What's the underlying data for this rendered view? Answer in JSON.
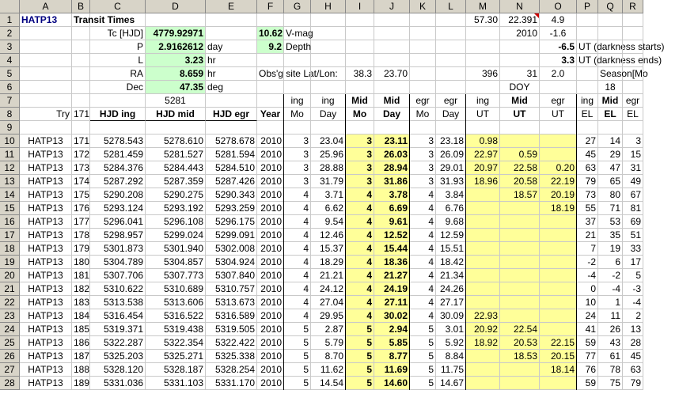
{
  "columns": [
    "A",
    "B",
    "C",
    "D",
    "E",
    "F",
    "G",
    "H",
    "I",
    "J",
    "K",
    "L",
    "M",
    "N",
    "O",
    "P",
    "Q",
    "R"
  ],
  "row_numbers": [
    "1",
    "2",
    "3",
    "4",
    "5",
    "6",
    "7",
    "8",
    "9",
    "10",
    "11",
    "12",
    "13",
    "14",
    "15",
    "16",
    "17",
    "18",
    "19",
    "20",
    "21",
    "22",
    "23",
    "24",
    "25",
    "26",
    "27",
    "28"
  ],
  "top": {
    "a1": "HATP13",
    "b1": "Transit Times",
    "m1": "57.30",
    "n1": "22.391",
    "o1": "4.9",
    "c2": "Tc [HJD]",
    "d2": "4779.92971",
    "f2": "10.62",
    "g2": "V-mag",
    "n2": "2010",
    "o2": "-1.6",
    "c3": "P",
    "d3": "2.9162612",
    "e3": "day",
    "f3": "9.2",
    "g3": "Depth",
    "o3": "-6.5",
    "p3": "UT (darkness starts)",
    "c4": "L",
    "d4": "3.23",
    "e4": "hr",
    "o4": "3.3",
    "p4": "UT (darkness ends)",
    "c5": "RA",
    "d5": "8.659",
    "e5": "hr",
    "f5": "Obs'g site Lat/Lon:",
    "i5": "38.3",
    "j5": "23.70",
    "m5": "396",
    "n5": "31",
    "o5": "2.0",
    "q5": "Season[Mo",
    "c6": "Dec",
    "d6": "47.35",
    "e6": "deg",
    "n6": "DOY",
    "q6": "18",
    "d7": "5281",
    "g7": "ing",
    "h7": "ing",
    "i7": "Mid",
    "j7": "Mid",
    "k7": "egr",
    "l7": "egr",
    "m7": "ing",
    "n7": "Mid",
    "o7": "egr",
    "p7": "ing",
    "q7": "Mid",
    "r7": "egr",
    "a8": "Try",
    "b8": "171",
    "c8": "HJD ing",
    "d8": "HJD mid",
    "e8": "HJD egr",
    "f8": "Year",
    "g8": "Mo",
    "h8": "Day",
    "i8": "Mo",
    "j8": "Day",
    "k8": "Mo",
    "l8": "Day",
    "m8": "UT",
    "n8": "UT",
    "o8": "UT",
    "p8": "EL",
    "q8": "EL",
    "r8": "EL"
  },
  "rows": [
    {
      "a": "HATP13",
      "b": "171",
      "c": "5278.543",
      "d": "5278.610",
      "e": "5278.678",
      "f": "2010",
      "g": "3",
      "h": "23.04",
      "i": "3",
      "j": "23.11",
      "k": "3",
      "l": "23.18",
      "m": "0.98",
      "n": "",
      "o": "",
      "p": "27",
      "q": "14",
      "r": "3"
    },
    {
      "a": "HATP13",
      "b": "172",
      "c": "5281.459",
      "d": "5281.527",
      "e": "5281.594",
      "f": "2010",
      "g": "3",
      "h": "25.96",
      "i": "3",
      "j": "26.03",
      "k": "3",
      "l": "26.09",
      "m": "22.97",
      "n": "0.59",
      "o": "",
      "p": "45",
      "q": "29",
      "r": "15"
    },
    {
      "a": "HATP13",
      "b": "173",
      "c": "5284.376",
      "d": "5284.443",
      "e": "5284.510",
      "f": "2010",
      "g": "3",
      "h": "28.88",
      "i": "3",
      "j": "28.94",
      "k": "3",
      "l": "29.01",
      "m": "20.97",
      "n": "22.58",
      "o": "0.20",
      "p": "63",
      "q": "47",
      "r": "31"
    },
    {
      "a": "HATP13",
      "b": "174",
      "c": "5287.292",
      "d": "5287.359",
      "e": "5287.426",
      "f": "2010",
      "g": "3",
      "h": "31.79",
      "i": "3",
      "j": "31.86",
      "k": "3",
      "l": "31.93",
      "m": "18.96",
      "n": "20.58",
      "o": "22.19",
      "p": "79",
      "q": "65",
      "r": "49"
    },
    {
      "a": "HATP13",
      "b": "175",
      "c": "5290.208",
      "d": "5290.275",
      "e": "5290.343",
      "f": "2010",
      "g": "4",
      "h": "3.71",
      "i": "4",
      "j": "3.78",
      "k": "4",
      "l": "3.84",
      "m": "",
      "n": "18.57",
      "o": "20.19",
      "p": "73",
      "q": "80",
      "r": "67"
    },
    {
      "a": "HATP13",
      "b": "176",
      "c": "5293.124",
      "d": "5293.192",
      "e": "5293.259",
      "f": "2010",
      "g": "4",
      "h": "6.62",
      "i": "4",
      "j": "6.69",
      "k": "4",
      "l": "6.76",
      "m": "",
      "n": "",
      "o": "18.19",
      "p": "55",
      "q": "71",
      "r": "81"
    },
    {
      "a": "HATP13",
      "b": "177",
      "c": "5296.041",
      "d": "5296.108",
      "e": "5296.175",
      "f": "2010",
      "g": "4",
      "h": "9.54",
      "i": "4",
      "j": "9.61",
      "k": "4",
      "l": "9.68",
      "m": "",
      "n": "",
      "o": "",
      "p": "37",
      "q": "53",
      "r": "69"
    },
    {
      "a": "HATP13",
      "b": "178",
      "c": "5298.957",
      "d": "5299.024",
      "e": "5299.091",
      "f": "2010",
      "g": "4",
      "h": "12.46",
      "i": "4",
      "j": "12.52",
      "k": "4",
      "l": "12.59",
      "m": "",
      "n": "",
      "o": "",
      "p": "21",
      "q": "35",
      "r": "51"
    },
    {
      "a": "HATP13",
      "b": "179",
      "c": "5301.873",
      "d": "5301.940",
      "e": "5302.008",
      "f": "2010",
      "g": "4",
      "h": "15.37",
      "i": "4",
      "j": "15.44",
      "k": "4",
      "l": "15.51",
      "m": "",
      "n": "",
      "o": "",
      "p": "7",
      "q": "19",
      "r": "33"
    },
    {
      "a": "HATP13",
      "b": "180",
      "c": "5304.789",
      "d": "5304.857",
      "e": "5304.924",
      "f": "2010",
      "g": "4",
      "h": "18.29",
      "i": "4",
      "j": "18.36",
      "k": "4",
      "l": "18.42",
      "m": "",
      "n": "",
      "o": "",
      "p": "-2",
      "q": "6",
      "r": "17"
    },
    {
      "a": "HATP13",
      "b": "181",
      "c": "5307.706",
      "d": "5307.773",
      "e": "5307.840",
      "f": "2010",
      "g": "4",
      "h": "21.21",
      "i": "4",
      "j": "21.27",
      "k": "4",
      "l": "21.34",
      "m": "",
      "n": "",
      "o": "",
      "p": "-4",
      "q": "-2",
      "r": "5"
    },
    {
      "a": "HATP13",
      "b": "182",
      "c": "5310.622",
      "d": "5310.689",
      "e": "5310.757",
      "f": "2010",
      "g": "4",
      "h": "24.12",
      "i": "4",
      "j": "24.19",
      "k": "4",
      "l": "24.26",
      "m": "",
      "n": "",
      "o": "",
      "p": "0",
      "q": "-4",
      "r": "-3"
    },
    {
      "a": "HATP13",
      "b": "183",
      "c": "5313.538",
      "d": "5313.606",
      "e": "5313.673",
      "f": "2010",
      "g": "4",
      "h": "27.04",
      "i": "4",
      "j": "27.11",
      "k": "4",
      "l": "27.17",
      "m": "",
      "n": "",
      "o": "",
      "p": "10",
      "q": "1",
      "r": "-4"
    },
    {
      "a": "HATP13",
      "b": "184",
      "c": "5316.454",
      "d": "5316.522",
      "e": "5316.589",
      "f": "2010",
      "g": "4",
      "h": "29.95",
      "i": "4",
      "j": "30.02",
      "k": "4",
      "l": "30.09",
      "m": "22.93",
      "n": "",
      "o": "",
      "p": "24",
      "q": "11",
      "r": "2"
    },
    {
      "a": "HATP13",
      "b": "185",
      "c": "5319.371",
      "d": "5319.438",
      "e": "5319.505",
      "f": "2010",
      "g": "5",
      "h": "2.87",
      "i": "5",
      "j": "2.94",
      "k": "5",
      "l": "3.01",
      "m": "20.92",
      "n": "22.54",
      "o": "",
      "p": "41",
      "q": "26",
      "r": "13"
    },
    {
      "a": "HATP13",
      "b": "186",
      "c": "5322.287",
      "d": "5322.354",
      "e": "5322.422",
      "f": "2010",
      "g": "5",
      "h": "5.79",
      "i": "5",
      "j": "5.85",
      "k": "5",
      "l": "5.92",
      "m": "18.92",
      "n": "20.53",
      "o": "22.15",
      "p": "59",
      "q": "43",
      "r": "28"
    },
    {
      "a": "HATP13",
      "b": "187",
      "c": "5325.203",
      "d": "5325.271",
      "e": "5325.338",
      "f": "2010",
      "g": "5",
      "h": "8.70",
      "i": "5",
      "j": "8.77",
      "k": "5",
      "l": "8.84",
      "m": "",
      "n": "18.53",
      "o": "20.15",
      "p": "77",
      "q": "61",
      "r": "45"
    },
    {
      "a": "HATP13",
      "b": "188",
      "c": "5328.120",
      "d": "5328.187",
      "e": "5328.254",
      "f": "2010",
      "g": "5",
      "h": "11.62",
      "i": "5",
      "j": "11.69",
      "k": "5",
      "l": "11.75",
      "m": "",
      "n": "",
      "o": "18.14",
      "p": "76",
      "q": "78",
      "r": "63"
    },
    {
      "a": "HATP13",
      "b": "189",
      "c": "5331.036",
      "d": "5331.103",
      "e": "5331.170",
      "f": "2010",
      "g": "5",
      "h": "14.54",
      "i": "5",
      "j": "14.60",
      "k": "5",
      "l": "14.67",
      "m": "",
      "n": "",
      "o": "",
      "p": "59",
      "q": "75",
      "r": "79"
    }
  ]
}
